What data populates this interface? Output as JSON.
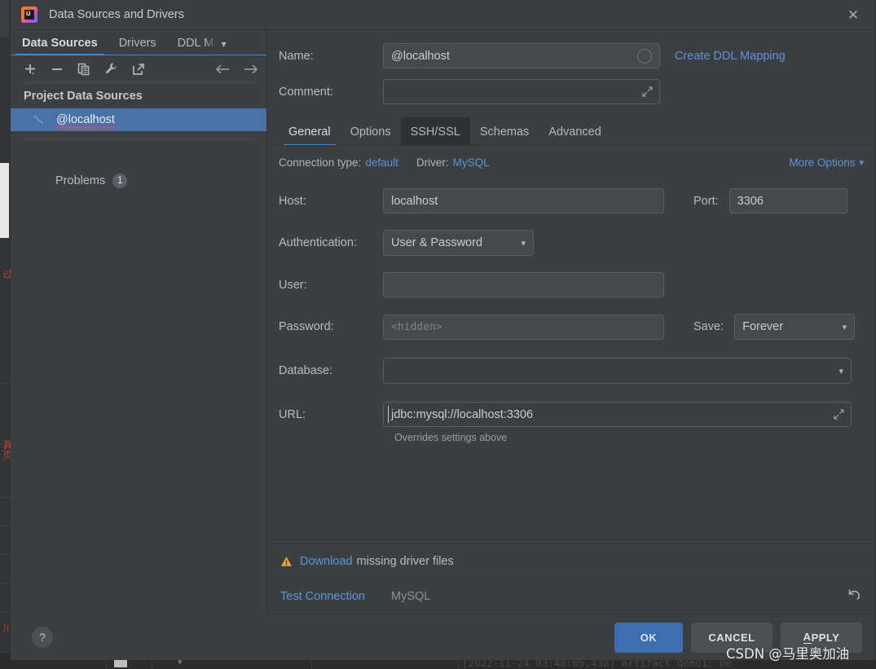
{
  "window": {
    "title": "Data Sources and Drivers",
    "app_icon": "intellij-idea-icon",
    "close_icon": "close-icon"
  },
  "sidebar": {
    "tabs": [
      {
        "label": "Data Sources",
        "active": true
      },
      {
        "label": "Drivers",
        "active": false
      },
      {
        "label": "DDL M",
        "active": false
      }
    ],
    "tabs_overflow_icon": "chevron-down-icon",
    "toolbar": [
      {
        "name": "add-button",
        "icon": "plus-icon"
      },
      {
        "name": "remove-button",
        "icon": "minus-icon"
      },
      {
        "name": "duplicate-button",
        "icon": "copy-icon"
      },
      {
        "name": "properties-button",
        "icon": "wrench-icon"
      },
      {
        "name": "jump-to-source-button",
        "icon": "external-link-icon"
      },
      {
        "name": "navigate-back-button",
        "icon": "arrow-left-icon"
      },
      {
        "name": "navigate-forward-button",
        "icon": "arrow-right-icon"
      }
    ],
    "group_label": "Project Data Sources",
    "items": [
      {
        "label": "@localhost",
        "icon": "mysql-dolphin-icon",
        "selected": true,
        "has_error": true
      }
    ],
    "problems": {
      "label": "Problems",
      "count": "1"
    }
  },
  "details": {
    "name": {
      "label": "Name:",
      "value": "@localhost",
      "placeholder": "",
      "color_icon": "circle-icon"
    },
    "create_ddl_mapping": "Create DDL Mapping",
    "comment": {
      "label": "Comment:",
      "value": "",
      "placeholder": "",
      "expand_icon": "expand-icon"
    },
    "tabs": [
      {
        "label": "General",
        "active": true,
        "hovered": false
      },
      {
        "label": "Options",
        "active": false,
        "hovered": false
      },
      {
        "label": "SSH/SSL",
        "active": false,
        "hovered": true
      },
      {
        "label": "Schemas",
        "active": false,
        "hovered": false
      },
      {
        "label": "Advanced",
        "active": false,
        "hovered": false
      }
    ],
    "connection_type_label": "Connection type:",
    "connection_type_value": "default",
    "driver_label": "Driver:",
    "driver_value": "MySQL",
    "more_options": "More Options",
    "more_options_icon": "chevron-down-icon",
    "host": {
      "label": "Host:",
      "value": "localhost"
    },
    "port": {
      "label": "Port:",
      "value": "3306"
    },
    "authentication": {
      "label": "Authentication:",
      "value": "User & Password",
      "icon": "chevron-down-icon"
    },
    "user": {
      "label": "User:",
      "value": "",
      "placeholder": ""
    },
    "password": {
      "label": "Password:",
      "value": "",
      "placeholder": "<hidden>"
    },
    "save": {
      "label": "Save:",
      "value": "Forever",
      "icon": "chevron-down-icon"
    },
    "database": {
      "label": "Database:",
      "value": "",
      "icon": "chevron-down-icon"
    },
    "url": {
      "label": "URL:",
      "value": "jdbc:mysql://localhost:3306",
      "expand_icon": "expand-icon"
    },
    "url_hint": "Overrides settings above"
  },
  "driver_banner": {
    "warning_icon": "warning-triangle-icon",
    "link": "Download",
    "rest": "missing driver files"
  },
  "test_banner": {
    "test_connection": "Test Connection",
    "driver_name": "MySQL",
    "reset_icon": "undo-icon"
  },
  "footer": {
    "help_icon": "help-question-icon",
    "ok": "OK",
    "cancel": "CANCEL",
    "apply_mnemonic": "A",
    "apply_rest": "PPLY"
  },
  "background": {
    "console_line": "[2022-11-24 03:48:05,438] Artifact demo1: De",
    "left_chars_top": "过",
    "left_chars_mid": "真页",
    "left_chars_bottom": "川"
  },
  "watermark": "CSDN @马里奥加油",
  "colors": {
    "accent_blue": "#5c93d8",
    "selection_blue": "#4a72a8",
    "primary_button": "#3c6eb0",
    "panel_bg": "#3c3f41",
    "field_bg": "#45494a",
    "warning_orange": "#f0a732"
  }
}
